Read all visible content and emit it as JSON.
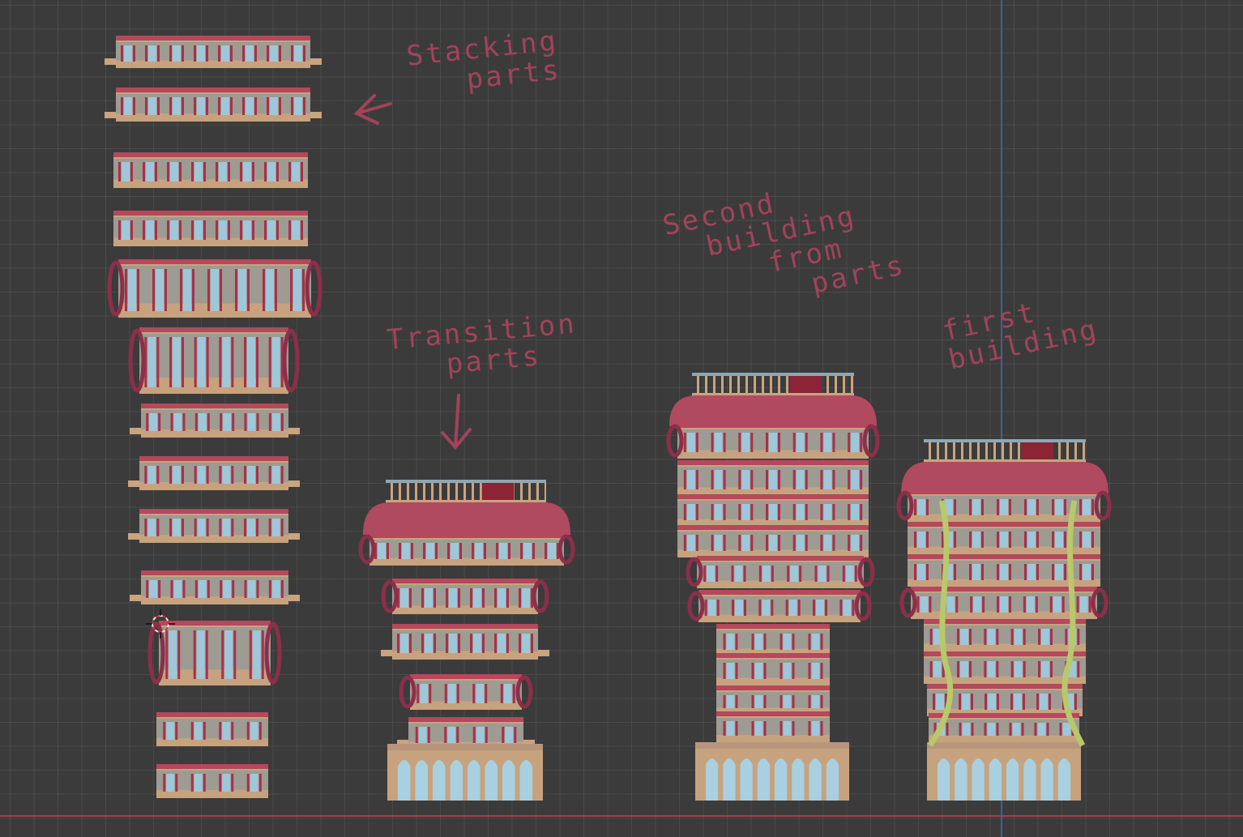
{
  "viewport": {
    "colors": {
      "background": "#3b3b3b",
      "x_axis": "#b23a48",
      "z_axis": "#3f5f9a",
      "annotation": "#a2435a"
    }
  },
  "annotations": {
    "stacking_parts": "Stacking\n   parts",
    "transition_parts": "Transition\n   parts",
    "second_building": "Second\n  building\n     from\n       parts",
    "first_building": "first\nbuilding"
  },
  "icons": {
    "cursor": "3d-cursor-icon",
    "arrow_left": "arrow-left-icon",
    "arrow_down": "arrow-down-icon"
  }
}
